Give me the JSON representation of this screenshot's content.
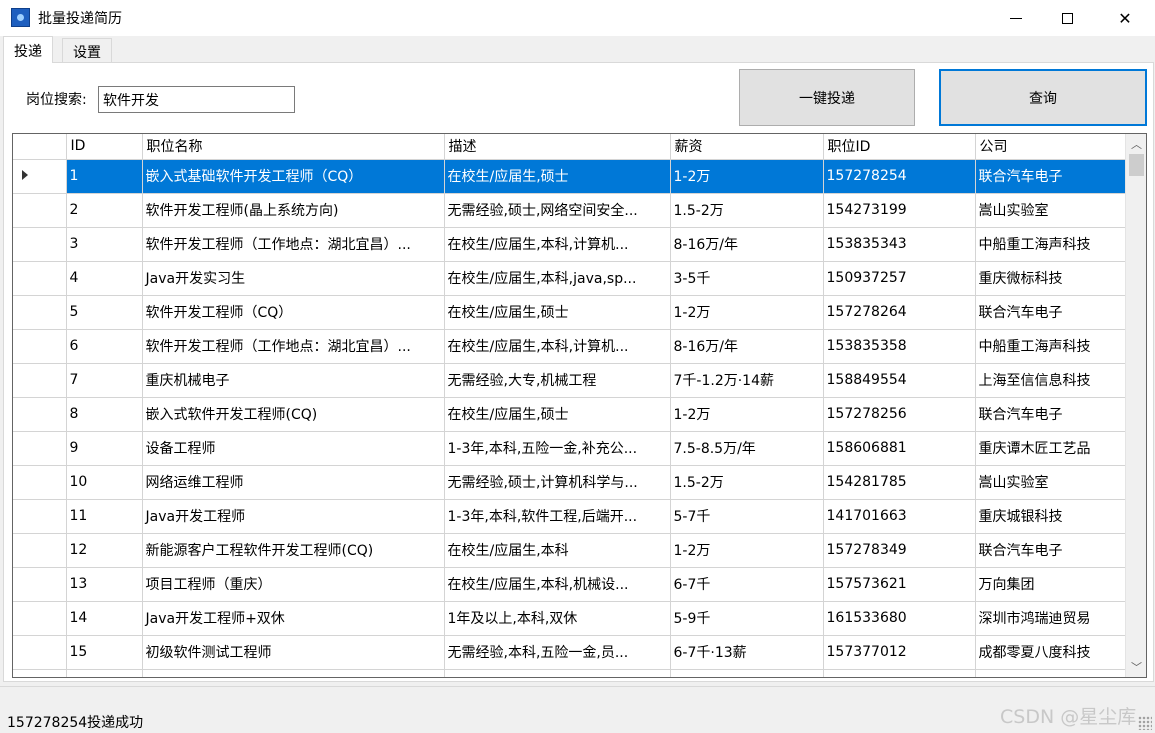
{
  "window": {
    "title": "批量投递简历",
    "icon": "app-icon",
    "controls": {
      "minimize": "minimize-icon",
      "maximize": "maximize-icon",
      "close": "close-icon"
    }
  },
  "tabs": [
    {
      "label": "投递",
      "active": true
    },
    {
      "label": "设置",
      "active": false
    }
  ],
  "search": {
    "label": "岗位搜索:",
    "value": "软件开发"
  },
  "buttons": {
    "submit_all": "一键投递",
    "query": "查询"
  },
  "grid": {
    "columns": [
      "ID",
      "职位名称",
      "描述",
      "薪资",
      "职位ID",
      "公司"
    ],
    "selected_row": 0,
    "rows": [
      {
        "id": "1",
        "name": "嵌入式基础软件开发工程师（CQ）",
        "desc": "在校生/应届生,硕士",
        "salary": "1-2万",
        "job_id": "157278254",
        "company": "联合汽车电子"
      },
      {
        "id": "2",
        "name": "软件开发工程师(晶上系统方向)",
        "desc": "无需经验,硕士,网络空间安全...",
        "salary": "1.5-2万",
        "job_id": "154273199",
        "company": "嵩山实验室"
      },
      {
        "id": "3",
        "name": "软件开发工程师（工作地点：湖北宜昌）...",
        "desc": "在校生/应届生,本科,计算机...",
        "salary": "8-16万/年",
        "job_id": "153835343",
        "company": "中船重工海声科技"
      },
      {
        "id": "4",
        "name": "Java开发实习生",
        "desc": "在校生/应届生,本科,java,sp...",
        "salary": "3-5千",
        "job_id": "150937257",
        "company": "重庆微标科技"
      },
      {
        "id": "5",
        "name": "软件开发工程师（CQ）",
        "desc": "在校生/应届生,硕士",
        "salary": "1-2万",
        "job_id": "157278264",
        "company": "联合汽车电子"
      },
      {
        "id": "6",
        "name": "软件开发工程师（工作地点：湖北宜昌）...",
        "desc": "在校生/应届生,本科,计算机...",
        "salary": "8-16万/年",
        "job_id": "153835358",
        "company": "中船重工海声科技"
      },
      {
        "id": "7",
        "name": "重庆机械电子",
        "desc": "无需经验,大专,机械工程",
        "salary": "7千-1.2万·14薪",
        "job_id": "158849554",
        "company": "上海至信信息科技"
      },
      {
        "id": "8",
        "name": "嵌入式软件开发工程师(CQ)",
        "desc": "在校生/应届生,硕士",
        "salary": "1-2万",
        "job_id": "157278256",
        "company": "联合汽车电子"
      },
      {
        "id": "9",
        "name": "设备工程师",
        "desc": "1-3年,本科,五险一金,补充公...",
        "salary": "7.5-8.5万/年",
        "job_id": "158606881",
        "company": "重庆谭木匠工艺品"
      },
      {
        "id": "10",
        "name": "网络运维工程师",
        "desc": "无需经验,硕士,计算机科学与...",
        "salary": "1.5-2万",
        "job_id": "154281785",
        "company": "嵩山实验室"
      },
      {
        "id": "11",
        "name": "Java开发工程师",
        "desc": "1-3年,本科,软件工程,后端开...",
        "salary": "5-7千",
        "job_id": "141701663",
        "company": "重庆城银科技"
      },
      {
        "id": "12",
        "name": "新能源客户工程软件开发工程师(CQ)",
        "desc": "在校生/应届生,本科",
        "salary": "1-2万",
        "job_id": "157278349",
        "company": "联合汽车电子"
      },
      {
        "id": "13",
        "name": "项目工程师（重庆）",
        "desc": "在校生/应届生,本科,机械设...",
        "salary": "6-7千",
        "job_id": "157573621",
        "company": "万向集团"
      },
      {
        "id": "14",
        "name": "Java开发工程师+双休",
        "desc": "1年及以上,本科,双休",
        "salary": "5-9千",
        "job_id": "161533680",
        "company": "深圳市鸿瑞迪贸易"
      },
      {
        "id": "15",
        "name": "初级软件测试工程师",
        "desc": "无需经验,本科,五险一金,员...",
        "salary": "6-7千·13薪",
        "job_id": "157377012",
        "company": "成都零夏八度科技"
      }
    ]
  },
  "status": {
    "message": "157278254投递成功",
    "watermark": "CSDN @星尘库"
  },
  "colors": {
    "selection": "#0078d7",
    "focus_border": "#0078d7"
  }
}
